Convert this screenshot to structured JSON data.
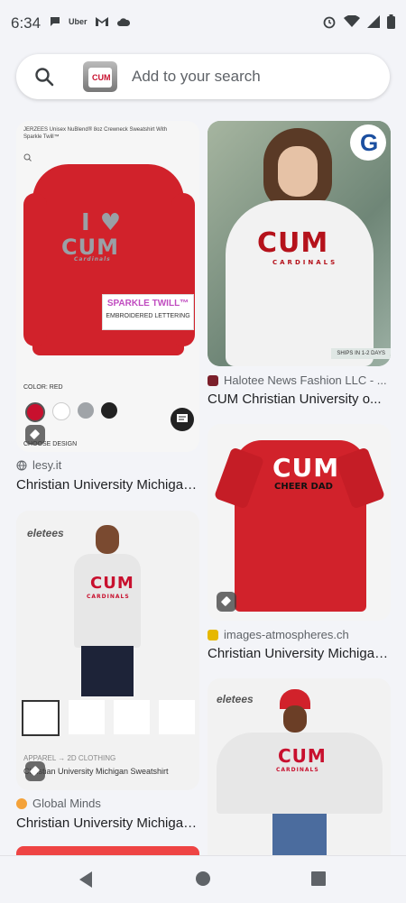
{
  "status": {
    "time": "6:34",
    "left_icons": [
      "chat-bubble-icon",
      "uber-icon",
      "gmail-icon",
      "cloud-icon"
    ],
    "uber_label": "Uber",
    "right_icons": [
      "alarm-icon",
      "wifi-icon",
      "signal-icon",
      "battery-icon"
    ]
  },
  "search": {
    "placeholder": "Add to your search",
    "thumb_text": "CUM"
  },
  "results": [
    {
      "image_top_text": "JERZEES Unisex NuBlend® 8oz Crewneck Sweatshirt With Sparkle Twill™",
      "shirt_text_line1": "I ♥",
      "shirt_text_line2": "CUM",
      "shirt_text_line3": "Cardinals",
      "sparkle_label": "SPARKLE TWILL™",
      "embroidered_label": "EMBROIDERED LETTERING",
      "color_label": "COLOR: RED",
      "choose_label": "CHOOSE DESIGN",
      "source": "lesy.it",
      "title": "Christian University Michigan..."
    },
    {
      "logo_text": "G",
      "shirt_text_line1": "CUM",
      "shirt_text_line2": "CARDINALS",
      "ships_label": "SHIPS IN 1-2 DAYS",
      "source": "Halotee News Fashion LLC - ...",
      "title": "CUM Christian University o..."
    },
    {
      "shirt_text_line1": "CUM",
      "shirt_text_line2": "CHEER DAD",
      "source": "images-atmospheres.ch",
      "title": "Christian University Michigan..."
    },
    {
      "brand": "eletees",
      "shirt_text_line1": "CUM",
      "shirt_text_line2": "CARDINALS",
      "breadcrumb": "APPAREL → 2D CLOTHING",
      "product_title": "Christian University Michigan Sweatshirt",
      "source": "Global Minds",
      "title": "Christian University Michigan..."
    },
    {
      "brand": "eletees",
      "shirt_text_line1": "CUM",
      "shirt_text_line2": "CARDINALS"
    }
  ],
  "colors": {
    "red": "#d1222b",
    "bg": "#f3f4f8"
  },
  "nav": [
    "back-icon",
    "home-icon",
    "recents-icon"
  ]
}
